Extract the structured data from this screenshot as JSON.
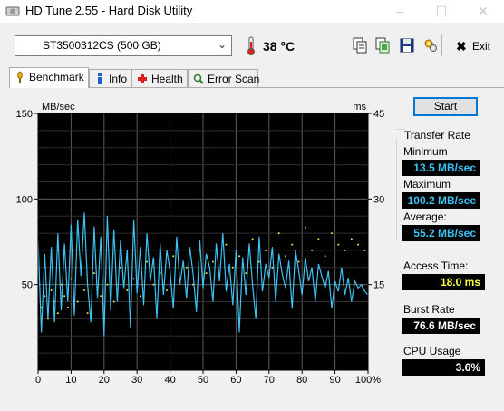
{
  "window": {
    "title": "HD Tune 2.55 - Hard Disk Utility",
    "controls": [
      "–",
      "☐",
      "✕"
    ]
  },
  "toolbar": {
    "drive": "ST3500312CS (500 GB)",
    "temperature": "38 °C",
    "exit_label": "Exit",
    "icons": [
      "copy-text-icon",
      "copy-screenshot-icon",
      "save-icon",
      "options-icon"
    ]
  },
  "tabs": [
    {
      "label": "Benchmark",
      "icon": "benchmark-icon",
      "active": true
    },
    {
      "label": "Info",
      "icon": "info-icon",
      "active": false
    },
    {
      "label": "Health",
      "icon": "health-icon",
      "active": false
    },
    {
      "label": "Error Scan",
      "icon": "error-scan-icon",
      "active": false
    }
  ],
  "start_button": "Start",
  "stats": {
    "transfer_rate_title": "Transfer Rate",
    "minimum_label": "Minimum",
    "minimum_value": "13.5 MB/sec",
    "maximum_label": "Maximum",
    "maximum_value": "100.2 MB/sec",
    "average_label": "Average:",
    "average_value": "55.2 MB/sec",
    "access_label": "Access Time:",
    "access_value": "18.0 ms",
    "burst_label": "Burst Rate",
    "burst_value": "76.6 MB/sec",
    "cpu_label": "CPU Usage",
    "cpu_value": "3.6%"
  },
  "colors": {
    "transfer_line": "#3ec2f2",
    "access_points": "#e8e84a",
    "plot_bg": "#000000",
    "grid": "#5a5a5a"
  },
  "chart_data": {
    "type": "line",
    "ylabel_left": "MB/sec",
    "ylabel_right": "ms",
    "x_ticks": [
      "0",
      "10",
      "20",
      "30",
      "40",
      "50",
      "60",
      "70",
      "80",
      "90",
      "100%"
    ],
    "y_ticks_left": [
      "150",
      "100",
      "50"
    ],
    "y_ticks_right": [
      "45",
      "30",
      "15"
    ],
    "xlim": [
      0,
      100
    ],
    "ylim_left": [
      0,
      150
    ],
    "ylim_right": [
      0,
      45
    ],
    "series": [
      {
        "kind": "transfer_rate",
        "x": [
          0,
          1,
          2,
          3,
          4,
          5,
          6,
          7,
          8,
          9,
          10,
          11,
          12,
          13,
          14,
          15,
          16,
          17,
          18,
          19,
          20,
          21,
          22,
          23,
          24,
          25,
          26,
          27,
          28,
          29,
          30,
          31,
          32,
          33,
          34,
          35,
          36,
          37,
          38,
          39,
          40,
          41,
          42,
          43,
          44,
          45,
          46,
          47,
          48,
          49,
          50,
          51,
          52,
          53,
          54,
          55,
          56,
          57,
          58,
          59,
          60,
          61,
          62,
          63,
          64,
          65,
          66,
          67,
          68,
          69,
          70,
          71,
          72,
          73,
          74,
          75,
          76,
          77,
          78,
          79,
          80,
          81,
          82,
          83,
          84,
          85,
          86,
          87,
          88,
          89,
          90,
          91,
          92,
          93,
          94,
          95,
          96,
          97,
          98,
          99,
          100
        ],
        "y": [
          76,
          22,
          68,
          30,
          72,
          28,
          80,
          35,
          74,
          40,
          85,
          32,
          88,
          55,
          92,
          50,
          28,
          84,
          42,
          78,
          20,
          90,
          35,
          82,
          40,
          76,
          48,
          70,
          25,
          88,
          45,
          72,
          38,
          80,
          52,
          66,
          30,
          74,
          44,
          70,
          58,
          36,
          78,
          50,
          64,
          42,
          72,
          56,
          34,
          76,
          48,
          68,
          60,
          40,
          74,
          52,
          80,
          46,
          62,
          38,
          70,
          22,
          66,
          44,
          74,
          50,
          30,
          78,
          46,
          62,
          54,
          72,
          40,
          68,
          56,
          48,
          64,
          36,
          70,
          58,
          44,
          66,
          52,
          60,
          40,
          62,
          55,
          48,
          58,
          36,
          52,
          46,
          60,
          44,
          54,
          40,
          52,
          48,
          50,
          46,
          44
        ]
      },
      {
        "kind": "access_time_ms",
        "x": [
          1,
          2,
          3,
          4,
          5,
          6,
          7,
          8,
          9,
          10,
          12,
          14,
          15,
          17,
          19,
          21,
          23,
          25,
          27,
          29,
          31,
          33,
          35,
          37,
          39,
          41,
          43,
          45,
          47,
          49,
          51,
          53,
          55,
          57,
          59,
          61,
          63,
          65,
          67,
          69,
          71,
          73,
          75,
          77,
          79,
          81,
          83,
          85,
          87,
          89,
          91,
          93,
          95,
          97,
          99
        ],
        "y": [
          11,
          13,
          9,
          14,
          12,
          10,
          15,
          13,
          11,
          16,
          12,
          14,
          10,
          17,
          13,
          15,
          12,
          18,
          14,
          16,
          13,
          19,
          15,
          17,
          14,
          20,
          16,
          18,
          15,
          21,
          17,
          19,
          16,
          22,
          18,
          20,
          17,
          23,
          19,
          21,
          18,
          24,
          20,
          22,
          19,
          25,
          21,
          23,
          20,
          24,
          22,
          21,
          23,
          22,
          21
        ]
      }
    ]
  }
}
